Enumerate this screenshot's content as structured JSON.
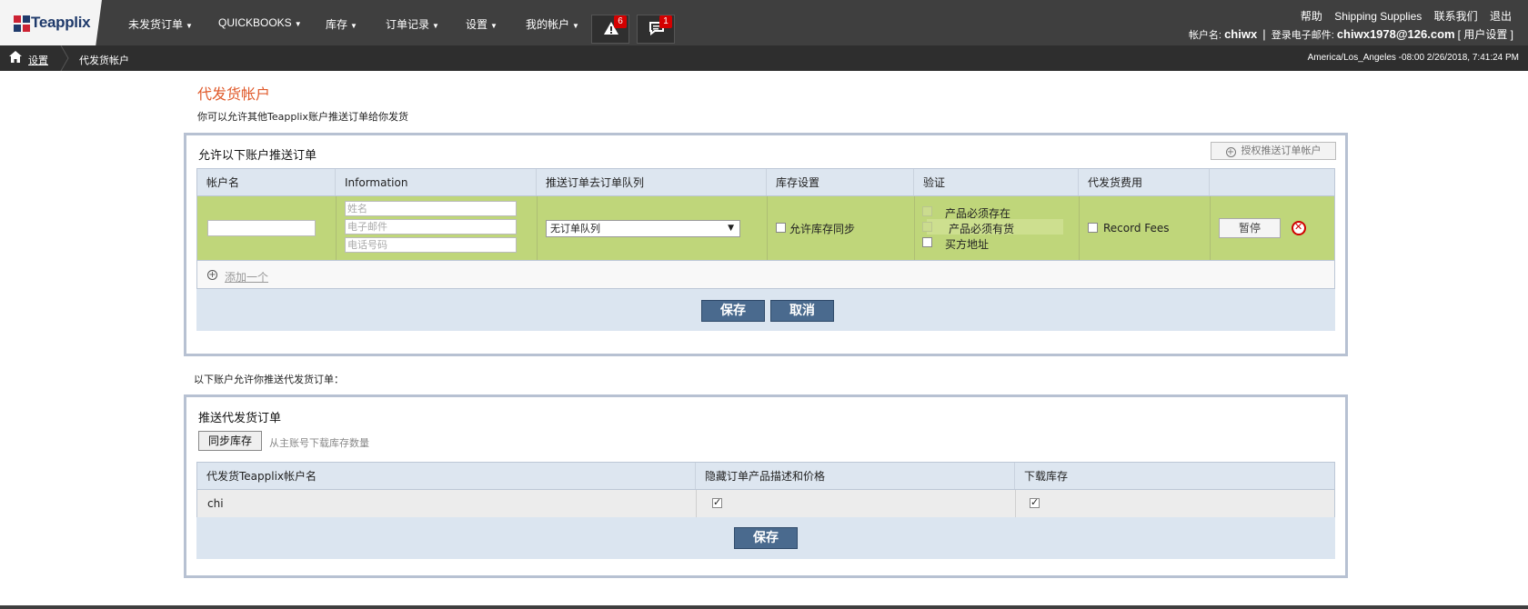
{
  "brand": {
    "name": "Teapplix",
    "colors": {
      "red": "#cc2233",
      "blue": "#1f3a6b"
    }
  },
  "nav": {
    "items": [
      {
        "label": "未发货订单"
      },
      {
        "label": "QUICKBOOKS"
      },
      {
        "label": "库存"
      },
      {
        "label": "订单记录"
      },
      {
        "label": "设置"
      },
      {
        "label": "我的帐户"
      }
    ],
    "alerts_count": "6",
    "messages_count": "1",
    "alert_icon": "warning-icon",
    "message_icon": "chat-icon"
  },
  "toplinks": {
    "help": "帮助",
    "shipping": "Shipping Supplies",
    "contact": "联系我们",
    "logout": "退出"
  },
  "user": {
    "account_label": "帐户名:",
    "account_name": "chiwx",
    "separator": "|",
    "email_label": "登录电子邮件:",
    "email": "chiwx1978@126.com",
    "settings_link": "[ 用户设置 ]"
  },
  "breadcrumb": {
    "home_icon": "home-icon",
    "parent": "设置",
    "current": "代发货帐户"
  },
  "timezone": "America/Los_Angeles -08:00 2/26/2018, 7:41:24 PM",
  "page": {
    "title": "代发货帐户",
    "description": "你可以允许其他Teapplix账户推送订单给你发货"
  },
  "allow_panel": {
    "title": "允许以下账户推送订单",
    "authorize_button": "授权推送订单帐户",
    "columns": [
      "帐户名",
      "Information",
      "推送订单去订单队列",
      "库存设置",
      "验证",
      "代发货费用"
    ],
    "row": {
      "account_value": "",
      "name_placeholder": "姓名",
      "email_placeholder": "电子邮件",
      "phone_placeholder": "电话号码",
      "queue_selected": "无订单队列",
      "inventory_sync_label": "允许库存同步",
      "inventory_sync_checked": false,
      "verify_options": [
        {
          "label": "产品必须存在",
          "checked": false,
          "disabled": true
        },
        {
          "label": "产品必须有货",
          "checked": false,
          "disabled": true
        },
        {
          "label": "买方地址",
          "checked": false,
          "disabled": false
        }
      ],
      "record_fees_label": "Record Fees",
      "record_fees_checked": false,
      "pause_button": "暂停",
      "delete_icon": "delete-icon"
    },
    "add_link": "添加一个",
    "save_button": "保存",
    "cancel_button": "取消"
  },
  "push_section_note": "以下账户允许你推送代发货订单：",
  "push_panel": {
    "title": "推送代发货订单",
    "sync_button": "同步库存",
    "sync_hint": "从主账号下载库存数量",
    "columns": [
      "代发货Teapplix帐户名",
      "隐藏订单产品描述和价格",
      "下载库存"
    ],
    "rows": [
      {
        "account": "chi",
        "hide_desc": true,
        "download_inventory": true
      }
    ],
    "save_button": "保存"
  }
}
